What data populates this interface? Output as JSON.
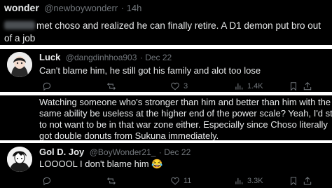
{
  "post1": {
    "name": "wonder",
    "handle": "@newboywonderr",
    "time": "· 14h",
    "text_line1": "met choso and realized he can finally retire. A D1 demon put bro out",
    "text_line2": "of a job"
  },
  "reply1": {
    "name": "Luck",
    "handle": "@dangdinhhoa903",
    "time": "· Dec 22",
    "text": "Can't blame him, he still got his family and alot too lose",
    "likes": "3",
    "views": "1.4K"
  },
  "reply2": {
    "text_line1": "Watching someone who's stronger than him and better than him with the",
    "text_line2": "same ability be useless at the higher end of the power scale? Yeah, I'd start",
    "text_line3": "to not want to be in that war zone either. Especially since Choso literally",
    "text_line4": "got double donuts from Sukuna immediately."
  },
  "reply3": {
    "name": "Gol D. Joy",
    "handle": "@BoyWonder21_",
    "time": "· Dec 22",
    "text": "LOOOOL I don't blame him 😂",
    "likes": "11",
    "views": "3.3K"
  },
  "colors": {
    "background": "#000000",
    "text": "#e7e9ea",
    "muted": "#71767b",
    "separator_band": "#ffffff"
  },
  "icons": [
    "reply-icon",
    "retweet-icon",
    "like-icon",
    "views-icon",
    "bookmark-icon",
    "share-icon"
  ]
}
